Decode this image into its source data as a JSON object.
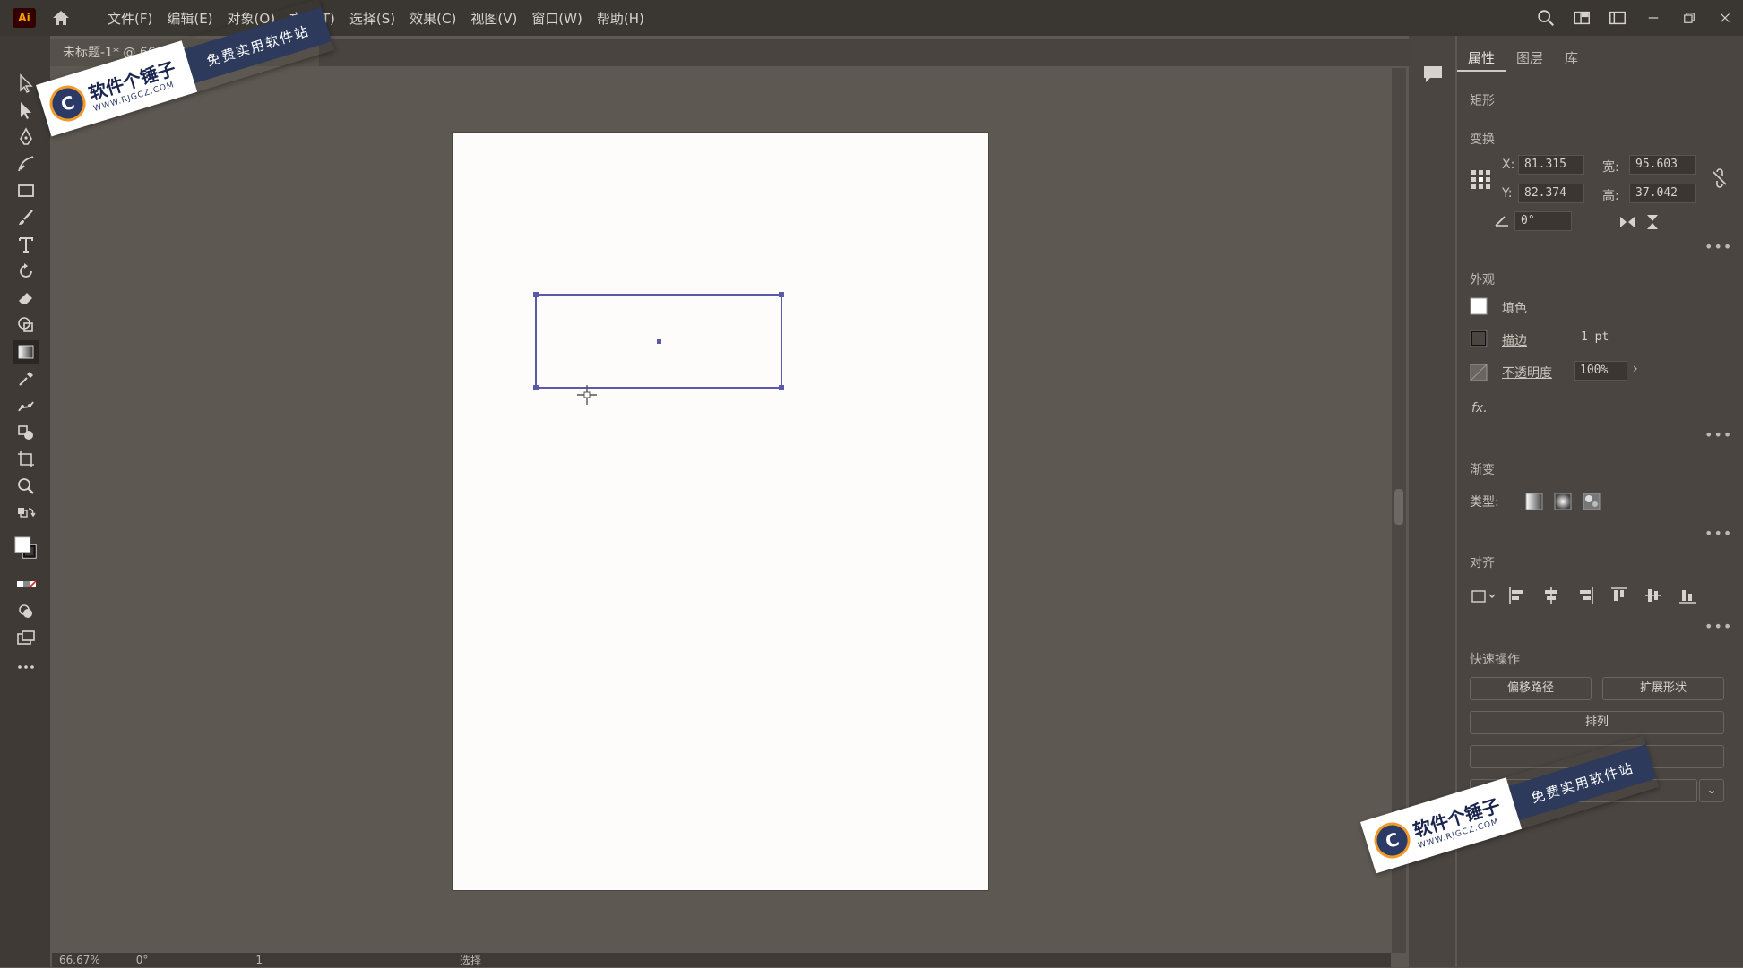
{
  "app": {
    "logo": "Ai"
  },
  "menu": {
    "items": [
      "文件(F)",
      "编辑(E)",
      "对象(O)",
      "文字(T)",
      "选择(S)",
      "效果(C)",
      "视图(V)",
      "窗口(W)",
      "帮助(H)"
    ]
  },
  "document": {
    "tab_title": "未标题-1* @ 66.67%"
  },
  "status": {
    "zoom": "66.67%",
    "rotation": "0°",
    "artboard_number": "1",
    "tool_name": "选择"
  },
  "panel": {
    "tabs": [
      "属性",
      "图层",
      "库"
    ],
    "object_type": "矩形",
    "transform": {
      "title": "变换",
      "x_label": "X:",
      "x_value": "81.315",
      "y_label": "Y:",
      "y_value": "82.374",
      "w_label": "宽:",
      "w_value": "95.603",
      "h_label": "高:",
      "h_value": "37.042",
      "angle_value": "0°"
    },
    "appearance": {
      "title": "外观",
      "fill_label": "填色",
      "stroke_label": "描边",
      "stroke_value": "1 pt",
      "opacity_label": "不透明度",
      "opacity_value": "100%",
      "fx_label": "fx."
    },
    "gradient": {
      "title": "渐变",
      "type_label": "类型:"
    },
    "align": {
      "title": "对齐"
    },
    "quick_actions": {
      "title": "快速操作",
      "offset_path": "偏移路径",
      "expand_shape": "扩展形状",
      "arrange": "排列"
    }
  },
  "watermark": {
    "brand": "软件个锤子",
    "url": "WWW.RJGCZ.COM",
    "slogan": "免费实用软件站"
  },
  "colors": {
    "selection": "#5a5aa8",
    "canvas": "#5e5852",
    "artboard": "#fdfcfb",
    "panel": "#4a4540"
  }
}
